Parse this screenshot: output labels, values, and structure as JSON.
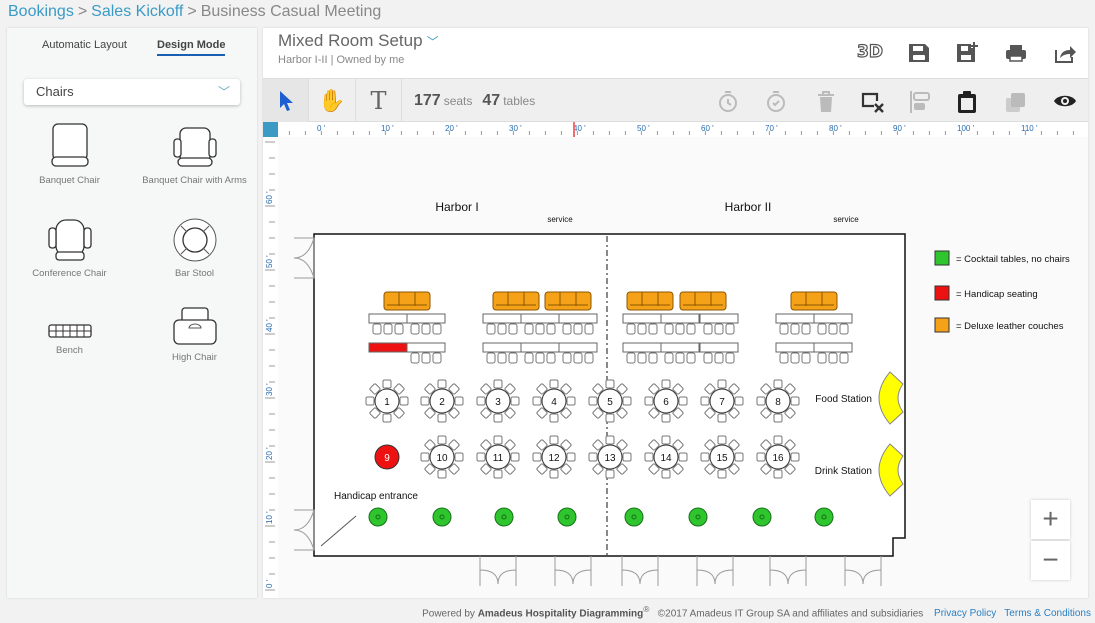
{
  "breadcrumb": {
    "items": [
      "Bookings",
      "Sales Kickoff"
    ],
    "current": "Business Casual Meeting"
  },
  "sidebar": {
    "tabs": [
      "Automatic Layout",
      "Design Mode"
    ],
    "active_tab": "Design Mode",
    "category": "Chairs",
    "items": [
      {
        "label": "Banquet Chair",
        "icon": "banquet-chair-icon"
      },
      {
        "label": "Banquet Chair with Arms",
        "icon": "banquet-chair-arms-icon"
      },
      {
        "label": "Conference Chair",
        "icon": "conference-chair-icon"
      },
      {
        "label": "Bar Stool",
        "icon": "bar-stool-icon"
      },
      {
        "label": "Bench",
        "icon": "bench-icon"
      },
      {
        "label": "High Chair",
        "icon": "high-chair-icon"
      }
    ]
  },
  "header": {
    "title": "Mixed Room Setup",
    "room": "Harbor I-II",
    "separator": "|",
    "owner": "Owned by me",
    "actions": [
      "3d-view",
      "save",
      "save-as",
      "print",
      "share"
    ],
    "three_d": "3D"
  },
  "toolbar": {
    "seats": "177",
    "seats_label": "seats",
    "tables": "47",
    "tables_label": "tables",
    "text_tool": "T"
  },
  "ruler": {
    "x_labels": [
      "0 '",
      "10 '",
      "20 '",
      "30 '",
      "40 '",
      "50 '",
      "60 '",
      "70 '",
      "80 '",
      "90 '",
      "100 '",
      "110 '"
    ],
    "y_labels": [
      "60 '",
      "50 '",
      "40 '",
      "30 '",
      "20 '",
      "10 '",
      "0 '"
    ]
  },
  "plan": {
    "rooms": [
      "Harbor I",
      "Harbor II"
    ],
    "service": "service",
    "round_tables_row1": [
      "1",
      "2",
      "3",
      "4",
      "5",
      "6",
      "7",
      "8"
    ],
    "round_tables_row2": [
      "9",
      "10",
      "11",
      "12",
      "13",
      "14",
      "15",
      "16"
    ],
    "handicap_table": "9",
    "labels": {
      "food": "Food Station",
      "drink": "Drink Station",
      "entrance": "Handicap entrance"
    },
    "colors": {
      "cocktail": "#2ec52e",
      "handicap": "#ee1111",
      "couch": "#f5a219",
      "station": "#ffff00"
    }
  },
  "legend": [
    {
      "color": "#2ec52e",
      "label": "= Cocktail tables, no chairs"
    },
    {
      "color": "#ee1111",
      "label": "= Handicap seating"
    },
    {
      "color": "#f5a219",
      "label": "= Deluxe leather couches"
    }
  ],
  "zoom": {
    "in": "+",
    "out": "−"
  },
  "footer": {
    "powered": "Powered by",
    "brand": "Amadeus Hospitality Diagramming",
    "reg": "®",
    "copyright": "©2017 Amadeus IT Group SA and affiliates and subsidiaries",
    "privacy": "Privacy Policy",
    "terms": "Terms & Conditions"
  }
}
